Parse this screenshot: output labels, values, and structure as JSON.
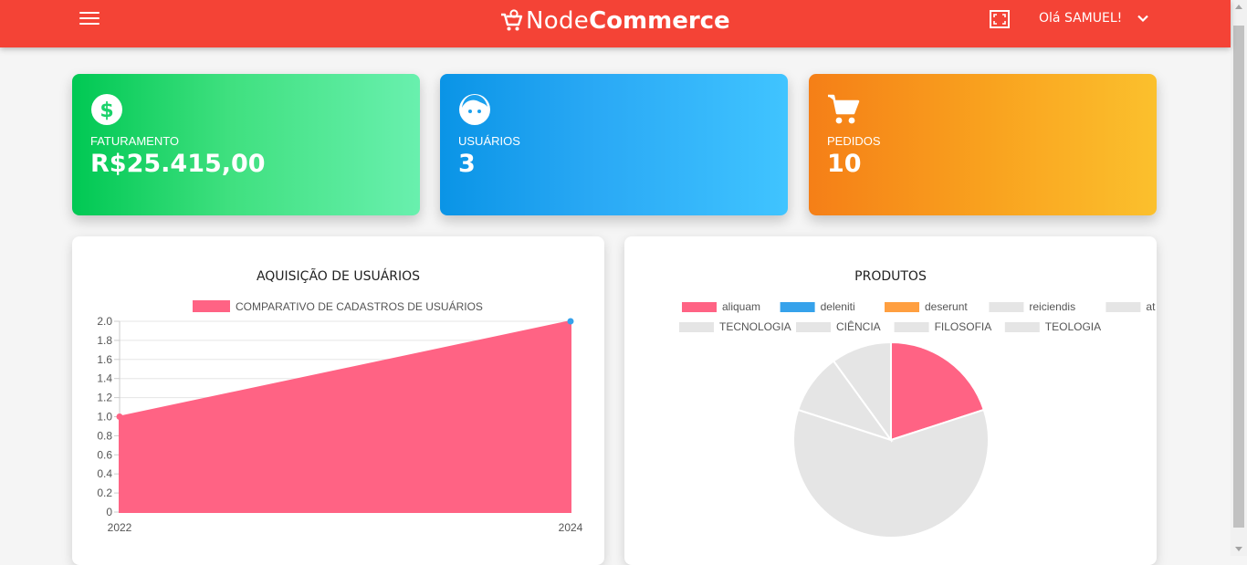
{
  "header": {
    "brand_light": "Node",
    "brand_bold": "Commerce",
    "greeting": "Olá SAMUEL!",
    "icons": [
      "menu-icon",
      "shopping-cart-icon",
      "fullscreen-icon",
      "chevron-down-icon"
    ]
  },
  "cards": [
    {
      "label": "FATURAMENTO",
      "value": "R$25.415,00",
      "icon": "dollar-circle-icon",
      "color_start": "#00c853",
      "color_end": "#69f0ae"
    },
    {
      "label": "USUÁRIOS",
      "value": "3",
      "icon": "face-icon",
      "color_start": "#0a94e6",
      "color_end": "#40c4ff"
    },
    {
      "label": "PEDIDOS",
      "value": "10",
      "icon": "shopping-cart-icon",
      "color_start": "#f57f17",
      "color_end": "#fbc02d"
    }
  ],
  "colors": {
    "header": "#f44336",
    "series_pink": "#ff6384",
    "series_blue": "#36a2eb",
    "series_orange": "#ff9f40",
    "grey": "#e5e5e5"
  },
  "chart_data": [
    {
      "type": "area",
      "title": "AQUISIÇÃO DE USUÁRIOS",
      "series": [
        {
          "name": "COMPARATIVO DE CADASTROS DE USUÁRIOS",
          "x": [
            "2022",
            "2024"
          ],
          "values": [
            1.0,
            2.0
          ],
          "color": "#ff6384"
        }
      ],
      "ylim": [
        0,
        2.0
      ],
      "yticks": [
        "0",
        "0.2",
        "0.4",
        "0.6",
        "0.8",
        "1.0",
        "1.2",
        "1.4",
        "1.6",
        "1.8",
        "2.0"
      ],
      "xticks": [
        "2022",
        "2024"
      ],
      "grid": true,
      "legend": "top"
    },
    {
      "type": "pie",
      "title": "PRODUTOS",
      "legend": "top",
      "labels": [
        "aliquam",
        "deleniti",
        "deserunt",
        "reiciendis",
        "at",
        "TECNOLOGIA",
        "CIÊNCIA",
        "FILOSOFIA",
        "TEOLOGIA"
      ],
      "legend_colors": [
        "#ff6384",
        "#36a2eb",
        "#ff9f40",
        "#e5e5e5",
        "#e5e5e5",
        "#e5e5e5",
        "#e5e5e5",
        "#e5e5e5",
        "#e5e5e5"
      ],
      "values": [
        2,
        0,
        0,
        0,
        0,
        6,
        1,
        1,
        0
      ],
      "slice_colors": [
        "#ff6384",
        "#36a2eb",
        "#ff9f40",
        "#e5e5e5",
        "#e5e5e5",
        "#e5e5e5",
        "#e5e5e5",
        "#e5e5e5",
        "#e5e5e5"
      ]
    }
  ]
}
